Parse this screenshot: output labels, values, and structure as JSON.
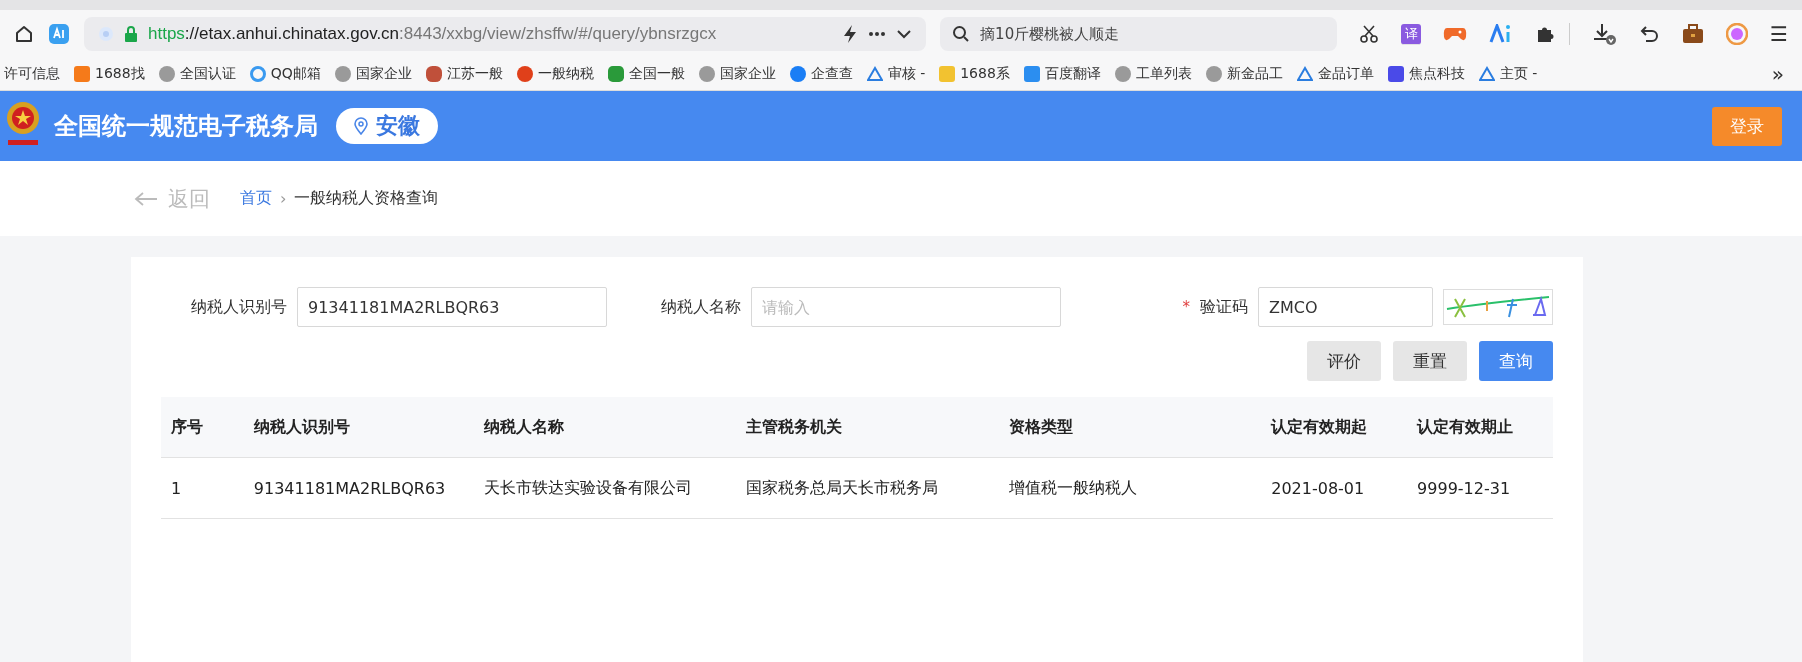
{
  "browser": {
    "url_scheme": "https",
    "url_host": "://etax.anhui.chinatax.gov.cn",
    "url_path": ":8443/xxbg/view/zhsffw/#/query/ybnsrzgcx",
    "search_placeholder": "摘10斤樱桃被人顺走",
    "toolbar_icons": [
      {
        "kind": "cut"
      },
      {
        "kind": "translate",
        "label": "译"
      },
      {
        "kind": "game"
      },
      {
        "kind": "ai"
      },
      {
        "kind": "puzzle"
      },
      {
        "kind": "divider"
      },
      {
        "kind": "download"
      },
      {
        "kind": "undo"
      },
      {
        "kind": "briefcase"
      },
      {
        "kind": "avatar"
      },
      {
        "kind": "menu",
        "label": "☰"
      }
    ],
    "bookmarks": [
      {
        "label": "许可信息"
      },
      {
        "label": "1688找"
      },
      {
        "label": "全国认证"
      },
      {
        "label": "QQ邮箱"
      },
      {
        "label": "国家企业"
      },
      {
        "label": "江苏一般"
      },
      {
        "label": "一般纳税"
      },
      {
        "label": "全国一般"
      },
      {
        "label": "国家企业"
      },
      {
        "label": "企查查"
      },
      {
        "label": "审核 -"
      },
      {
        "label": "1688系"
      },
      {
        "label": "百度翻译"
      },
      {
        "label": "工单列表"
      },
      {
        "label": "新金品工"
      },
      {
        "label": "金品订单"
      },
      {
        "label": "焦点科技"
      },
      {
        "label": "主页 -"
      }
    ],
    "more": "»"
  },
  "header": {
    "title": "全国统一规范电子税务局",
    "region": "安徽",
    "login": "登录"
  },
  "breadcrumb": {
    "back": "返回",
    "items": [
      {
        "label": "首页",
        "link": true
      },
      {
        "label": "一般纳税人资格查询",
        "link": false
      }
    ],
    "separator": "›"
  },
  "form": {
    "fields": [
      {
        "label": "纳税人识别号",
        "value": "91341181MA2RLBQR63",
        "required": false
      },
      {
        "label": "纳税人名称",
        "placeholder": "请输入",
        "required": false
      },
      {
        "label": "验证码",
        "value": "ZMCO",
        "required": true,
        "required_mark": "*"
      }
    ],
    "buttons": [
      {
        "label": "评价",
        "primary": false
      },
      {
        "label": "重置",
        "primary": false
      },
      {
        "label": "查询",
        "primary": true
      }
    ]
  },
  "table": {
    "columns": [
      "序号",
      "纳税人识别号",
      "纳税人名称",
      "主管税务机关",
      "资格类型",
      "认定有效期起",
      "认定有效期止"
    ],
    "rows": [
      [
        "1",
        "91341181MA2RLBQR63",
        "天长市轶达实验设备有限公司",
        "国家税务总局天长市税务局",
        "增值税一般纳税人",
        "2021-08-01",
        "9999-12-31"
      ]
    ]
  }
}
